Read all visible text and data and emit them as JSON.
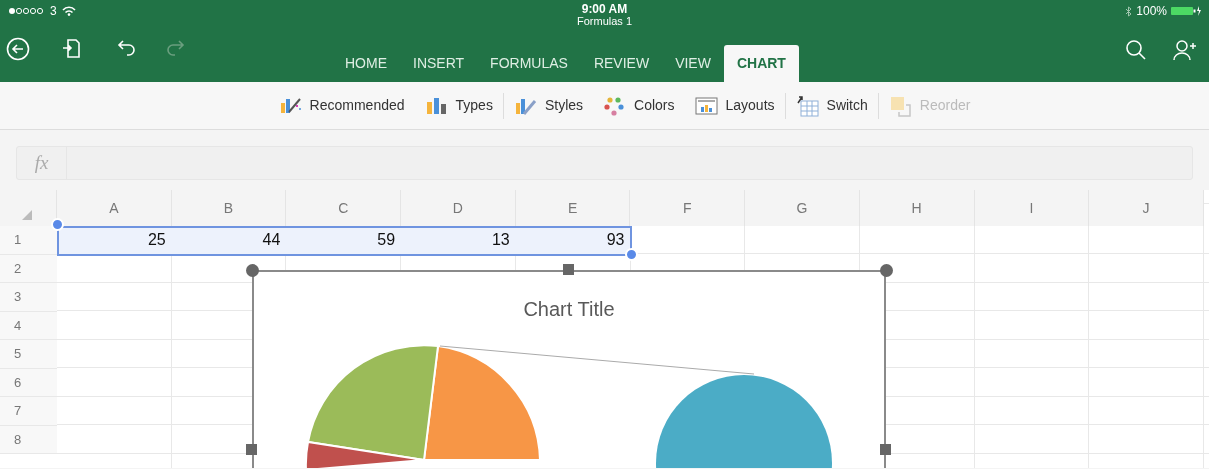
{
  "status_bar": {
    "carrier": "3",
    "time": "9:00 AM",
    "document_title": "Formulas 1",
    "battery": "100%"
  },
  "tabs": [
    {
      "label": "HOME",
      "selected": false
    },
    {
      "label": "INSERT",
      "selected": false
    },
    {
      "label": "FORMULAS",
      "selected": false
    },
    {
      "label": "REVIEW",
      "selected": false
    },
    {
      "label": "VIEW",
      "selected": false
    },
    {
      "label": "CHART",
      "selected": true
    }
  ],
  "ribbon": [
    {
      "kind": "recommended",
      "label": "Recommended",
      "disabled": false
    },
    {
      "kind": "types",
      "label": "Types",
      "disabled": false
    },
    {
      "kind": "styles",
      "label": "Styles",
      "disabled": false
    },
    {
      "kind": "colors",
      "label": "Colors",
      "disabled": false
    },
    {
      "kind": "layouts",
      "label": "Layouts",
      "disabled": false
    },
    {
      "kind": "switch",
      "label": "Switch",
      "disabled": false
    },
    {
      "kind": "reorder",
      "label": "Reorder",
      "disabled": true
    }
  ],
  "formula_bar": {
    "label": "fx"
  },
  "grid": {
    "columns": [
      "A",
      "B",
      "C",
      "D",
      "E",
      "F",
      "G",
      "H",
      "I",
      "J"
    ],
    "rows": [
      {
        "label": "1",
        "cells": [
          {
            "value": "25",
            "selected": true
          },
          {
            "value": "44",
            "selected": true
          },
          {
            "value": "59",
            "selected": true
          },
          {
            "value": "13",
            "selected": true
          },
          {
            "value": "93",
            "selected": true
          }
        ]
      },
      {
        "label": "2"
      },
      {
        "label": "3"
      },
      {
        "label": "4"
      },
      {
        "label": "5"
      },
      {
        "label": "6"
      },
      {
        "label": "7"
      },
      {
        "label": "8"
      }
    ]
  },
  "chart": {
    "title": "Chart Title"
  }
}
